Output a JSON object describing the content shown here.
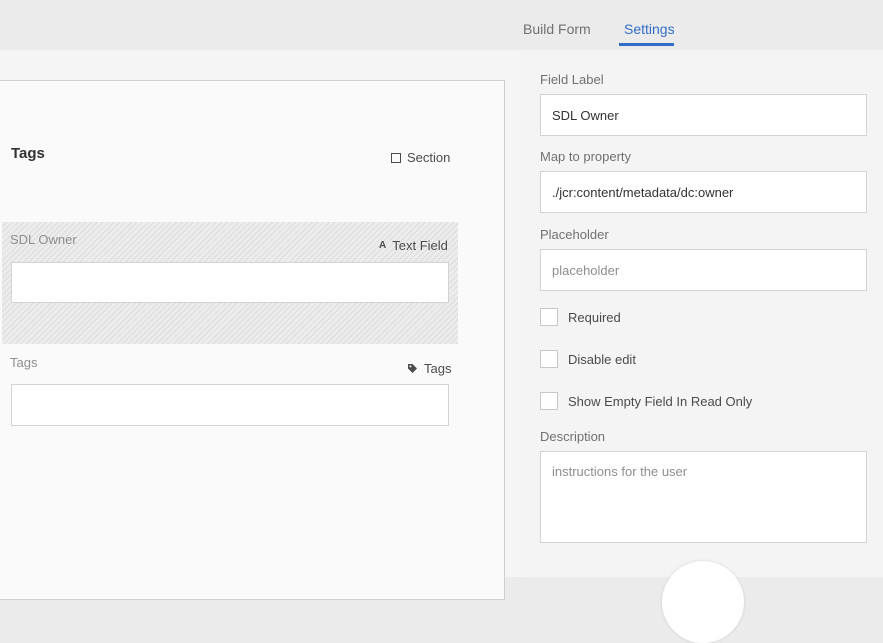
{
  "tabs": {
    "build_form": "Build Form",
    "settings": "Settings"
  },
  "form": {
    "section": {
      "title": "Tags",
      "type_label": "Section",
      "type_icon": "square-icon"
    },
    "fields": [
      {
        "label": "SDL Owner",
        "type_label": "Text Field",
        "type_icon": "text-field-icon",
        "selected": true
      },
      {
        "label": "Tags",
        "type_label": "Tags",
        "type_icon": "tag-icon",
        "selected": false
      }
    ]
  },
  "settings": {
    "field_label": {
      "label": "Field Label",
      "value": "SDL Owner"
    },
    "map_to_property": {
      "label": "Map to property",
      "value": "./jcr:content/metadata/dc:owner"
    },
    "placeholder": {
      "label": "Placeholder",
      "value": "placeholder"
    },
    "checkboxes": [
      {
        "label": "Required",
        "checked": false
      },
      {
        "label": "Disable edit",
        "checked": false
      },
      {
        "label": "Show Empty Field In Read Only",
        "checked": false
      }
    ],
    "description": {
      "label": "Description",
      "placeholder": "instructions for the user"
    }
  },
  "colors": {
    "accent": "#326ec8"
  }
}
